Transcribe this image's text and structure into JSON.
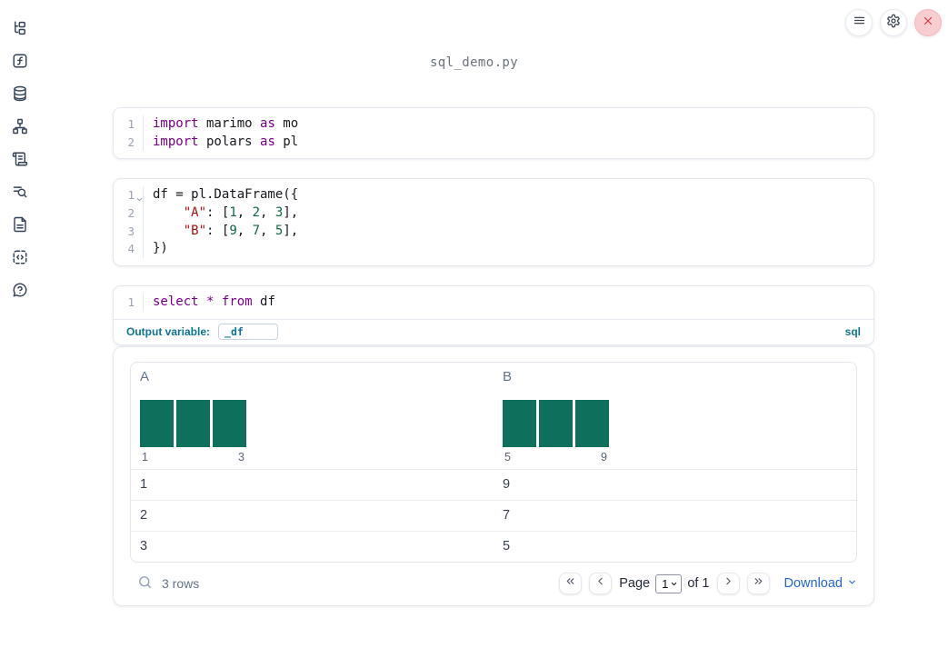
{
  "app": {
    "title": "sql_demo.py"
  },
  "topbar": {
    "menu_button": "menu",
    "settings_button": "settings",
    "close_button": "close"
  },
  "sidebar": {
    "items": [
      {
        "name": "file-explorer"
      },
      {
        "name": "functions"
      },
      {
        "name": "data-sources"
      },
      {
        "name": "dependency-graph"
      },
      {
        "name": "outline"
      },
      {
        "name": "logs"
      },
      {
        "name": "documentation"
      },
      {
        "name": "snippets"
      },
      {
        "name": "help"
      }
    ]
  },
  "cells": [
    {
      "id": "imports-cell",
      "lines": [
        {
          "num": "1",
          "tokens": [
            {
              "t": "kw",
              "v": "import"
            },
            {
              "t": "p",
              "v": " marimo "
            },
            {
              "t": "kw",
              "v": "as"
            },
            {
              "t": "p",
              "v": " mo"
            }
          ]
        },
        {
          "num": "2",
          "tokens": [
            {
              "t": "kw",
              "v": "import"
            },
            {
              "t": "p",
              "v": " polars "
            },
            {
              "t": "kw",
              "v": "as"
            },
            {
              "t": "p",
              "v": " pl"
            }
          ]
        }
      ]
    },
    {
      "id": "dataframe-cell",
      "lines": [
        {
          "num": "1",
          "fold": true,
          "tokens": [
            {
              "t": "p",
              "v": "df = pl.DataFrame({"
            }
          ]
        },
        {
          "num": "2",
          "tokens": [
            {
              "t": "p",
              "v": "    "
            },
            {
              "t": "str",
              "v": "\"A\""
            },
            {
              "t": "p",
              "v": ": ["
            },
            {
              "t": "num",
              "v": "1"
            },
            {
              "t": "p",
              "v": ", "
            },
            {
              "t": "num",
              "v": "2"
            },
            {
              "t": "p",
              "v": ", "
            },
            {
              "t": "num",
              "v": "3"
            },
            {
              "t": "p",
              "v": "],"
            }
          ]
        },
        {
          "num": "3",
          "tokens": [
            {
              "t": "p",
              "v": "    "
            },
            {
              "t": "str",
              "v": "\"B\""
            },
            {
              "t": "p",
              "v": ": ["
            },
            {
              "t": "num",
              "v": "9"
            },
            {
              "t": "p",
              "v": ", "
            },
            {
              "t": "num",
              "v": "7"
            },
            {
              "t": "p",
              "v": ", "
            },
            {
              "t": "num",
              "v": "5"
            },
            {
              "t": "p",
              "v": "],"
            }
          ]
        },
        {
          "num": "4",
          "tokens": [
            {
              "t": "p",
              "v": "})"
            }
          ]
        }
      ]
    },
    {
      "id": "sql-cell",
      "lines": [
        {
          "num": "1",
          "tokens": [
            {
              "t": "kw",
              "v": "select"
            },
            {
              "t": "p",
              "v": " "
            },
            {
              "t": "kw",
              "v": "*"
            },
            {
              "t": "p",
              "v": " "
            },
            {
              "t": "kw",
              "v": "from"
            },
            {
              "t": "p",
              "v": " df"
            }
          ]
        }
      ],
      "footer": {
        "output_variable_label": "Output variable:",
        "output_variable_value": "_df",
        "language_label": "sql"
      }
    }
  ],
  "output_table": {
    "columns": [
      {
        "name": "A",
        "bars": 3,
        "min_label": "1",
        "max_label": "3"
      },
      {
        "name": "B",
        "bars": 3,
        "min_label": "5",
        "max_label": "9"
      }
    ],
    "rows": [
      [
        "1",
        "9"
      ],
      [
        "2",
        "7"
      ],
      [
        "3",
        "5"
      ]
    ],
    "footer": {
      "row_count_label": "3 rows",
      "page_label": "Page",
      "page_value": "1",
      "of_label": "of 1",
      "download_label": "Download"
    }
  },
  "colors": {
    "keyword": "#770088",
    "string": "#aa1111",
    "number": "#116644",
    "label_teal": "#0e7490",
    "link_blue": "#2467d1",
    "bar_teal": "#0e6f5c"
  }
}
